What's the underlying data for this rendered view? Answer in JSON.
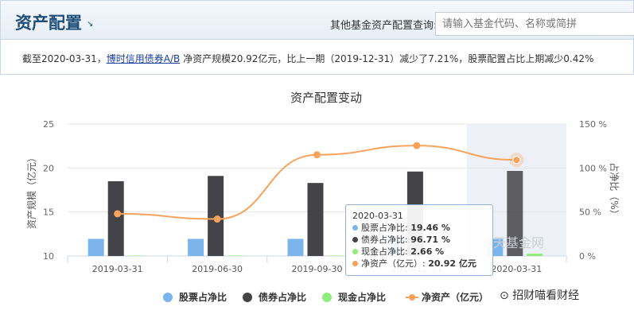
{
  "header": {
    "title": "资产配置",
    "query_label": "其他基金资产配置查询:",
    "search_placeholder": "请输入基金代码、名称或简拼"
  },
  "summary": {
    "prefix": "截至2020-03-31，",
    "fund_name": "博时信用债券A/B",
    "suffix": " 净资产规模20.92亿元，比上一期（2019-12-31）减少了7.21%，股票配置占比上期减少0.42%"
  },
  "chart_data": {
    "type": "bar",
    "title": "资产配置变动",
    "categories": [
      "2019-03-31",
      "2019-06-30",
      "2019-09-30",
      "2019-12-31",
      "2020-03-31"
    ],
    "series": [
      {
        "name": "股票占净比",
        "type": "bar",
        "axis": "right",
        "color": "#7cb5ec",
        "values": [
          19.5,
          19.5,
          19.5,
          19.9,
          19.46
        ]
      },
      {
        "name": "债券占净比",
        "type": "bar",
        "axis": "right",
        "color": "#434348",
        "values": [
          85,
          91,
          83,
          96,
          96.71
        ]
      },
      {
        "name": "现金占净比",
        "type": "bar",
        "axis": "right",
        "color": "#90ed7d",
        "values": [
          0.5,
          0.5,
          0.5,
          0.5,
          2.66
        ]
      },
      {
        "name": "净资产（亿元）",
        "type": "line",
        "axis": "left",
        "color": "#f7a35c",
        "values": [
          14.8,
          14.2,
          21.5,
          22.55,
          20.92
        ]
      }
    ],
    "ylabel_left": "资产规模（亿元）",
    "ylabel_right": "占净比（%）",
    "ylim_left": [
      10,
      25
    ],
    "yticks_left": [
      "10",
      "15",
      "20",
      "25"
    ],
    "ylim_right": [
      0,
      150
    ],
    "yticks_right": [
      "0 %",
      "50 %",
      "100 %",
      "150 %"
    ],
    "highlighted": "2020-03-31",
    "legend_position": "bottom"
  },
  "tooltip": {
    "date": "2020-03-31",
    "rows": [
      {
        "label": "股票占净比: ",
        "value": "19.46 %",
        "color": "#7cb5ec"
      },
      {
        "label": "债券占净比: ",
        "value": "96.71 %",
        "color": "#434348"
      },
      {
        "label": "现金占净比: ",
        "value": "2.66 %",
        "color": "#90ed7d"
      },
      {
        "label": "净资产（亿元）: ",
        "value": "20.92 亿元",
        "color": "#f7a35c"
      }
    ]
  },
  "watermark": "天天基金网",
  "wechat": "招财喵看财经"
}
